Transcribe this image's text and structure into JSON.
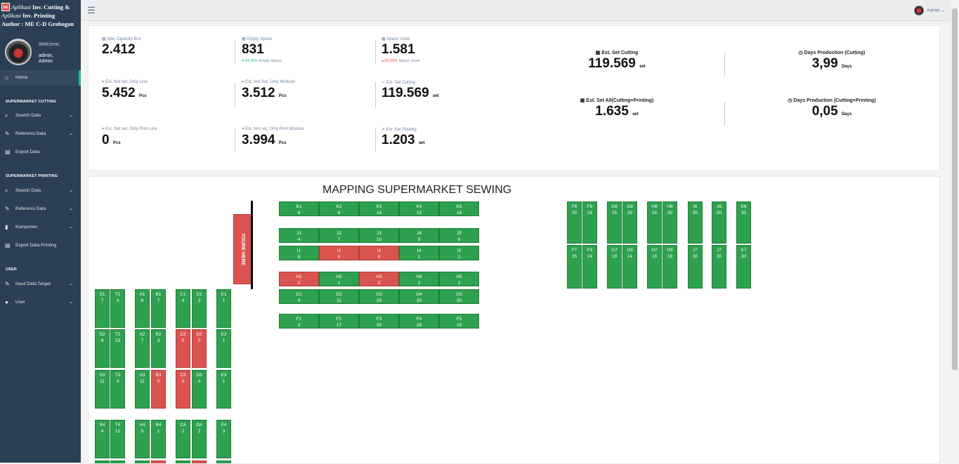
{
  "brand": {
    "logo": "DK",
    "line1_italic": "Aplikasi",
    "line1_bold": "Inv. Cutting &",
    "line2_italic": "Aplikasi",
    "line2_bold": "Inv. Printing",
    "line3": "Author : ME C-D Grobogan"
  },
  "profile": {
    "welcome": "Welcome,",
    "name": "admin,",
    "role": "Admin"
  },
  "nav": {
    "home": "Home",
    "sec_cutting": "SUPERMARKET CUTTING",
    "cut_search": "Search Data",
    "cut_ref": "Referensi Data",
    "cut_export": "Export Data",
    "sec_printing": "SUPERMARKET PRINTING",
    "prt_search": "Search Data",
    "prt_ref": "Referensi Data",
    "prt_komponen": "Komponen",
    "prt_export": "Export Data Printing",
    "sec_user": "USER",
    "input_target": "Input Data Target",
    "user": "User"
  },
  "topbar": {
    "user": "Admin"
  },
  "stats": {
    "max_capacity": {
      "label": "Max Capacity Box",
      "value": "2.412"
    },
    "empty_space": {
      "label": "Empty Space",
      "value": "831",
      "sub_pct": "34,45%",
      "sub_txt": "Empty Space"
    },
    "space_used": {
      "label": "Space Used",
      "value": "1.581",
      "sub_pct": "65,55%",
      "sub_txt": "Space Used"
    },
    "only_line": {
      "label": "Est. Not set, Only Line",
      "value": "5.452",
      "unit": "Pcs"
    },
    "only_modular": {
      "label": "Est. Not Set, Only Modular",
      "value": "3.512",
      "unit": "Pcs"
    },
    "set_cutting_small": {
      "label": "Est. Set Cutting",
      "value": "119.569",
      "unit": "set"
    },
    "print_line": {
      "label": "Est. Not set, Only Print Line",
      "value": "0",
      "unit": "Pcs"
    },
    "print_modular": {
      "label": "Est. Not set, Only Print Modular",
      "value": "3.994",
      "unit": "Pcs"
    },
    "set_printing": {
      "label": "Est. Set Printing",
      "value": "1.203",
      "unit": "set"
    },
    "big_set_cutting": {
      "label": "Est. Set Cutting",
      "value": "119.569",
      "unit": "set"
    },
    "big_days_cutting": {
      "label": "Days Production (Cutting)",
      "value": "3,99",
      "unit": "Days"
    },
    "big_set_all": {
      "label": "Est. Set All(Cutting+Printing)",
      "value": "1.635",
      "unit": "set"
    },
    "big_days_all": {
      "label": "Days Production (Cutting+Printing)",
      "value": "0,05",
      "unit": "Days"
    }
  },
  "map": {
    "title": "MAPPING SUPERMARKET SEWING",
    "youre_here": "YOURE HERE",
    "colors": {
      "ok": "#2ea14f",
      "empty": "#d9534f"
    },
    "rows": [
      [
        "K1",
        "6"
      ],
      [
        "K2",
        "6"
      ],
      [
        "K3",
        "14"
      ],
      [
        "K4",
        "12"
      ],
      [
        "K5",
        "16"
      ],
      [
        "J1",
        "4"
      ],
      [
        "J2",
        "7"
      ],
      [
        "J3",
        "10"
      ],
      [
        "J4",
        "9"
      ],
      [
        "J5",
        "6"
      ],
      [
        "I1",
        "8"
      ],
      [
        "I2",
        "0"
      ],
      [
        "I3",
        "0"
      ],
      [
        "I4",
        "1"
      ],
      [
        "I5",
        "2"
      ],
      [
        "H1",
        "0"
      ],
      [
        "H2",
        "1"
      ],
      [
        "H3",
        "0"
      ],
      [
        "H4",
        "2"
      ],
      [
        "H5",
        "2"
      ],
      [
        "G1",
        "4"
      ],
      [
        "G2",
        "11"
      ],
      [
        "G3",
        "29"
      ],
      [
        "G4",
        "30"
      ],
      [
        "G5",
        "30"
      ],
      [
        "F1",
        "3"
      ],
      [
        "F2",
        "17"
      ],
      [
        "F3",
        "30"
      ],
      [
        "F4",
        "28"
      ],
      [
        "F5",
        "19"
      ]
    ],
    "right_top": [
      [
        "F6",
        "20"
      ],
      [
        "F8",
        "16"
      ],
      [
        "G6",
        "15"
      ],
      [
        "G8",
        "20"
      ],
      [
        "H6",
        "14"
      ],
      [
        "H8",
        "30"
      ],
      [
        "I6",
        "30"
      ],
      [
        "J6",
        "30"
      ],
      [
        "K6",
        "30"
      ]
    ],
    "right_bottom": [
      [
        "F7",
        "25"
      ],
      [
        "F9",
        "24"
      ],
      [
        "G7",
        "19"
      ],
      [
        "G9",
        "14"
      ],
      [
        "H7",
        "16"
      ],
      [
        "H9",
        "18"
      ],
      [
        "I7",
        "30"
      ],
      [
        "J7",
        "30"
      ],
      [
        "K7",
        "30"
      ]
    ],
    "left_rows": [
      [
        [
          "S1",
          "7"
        ],
        [
          "T1",
          "4"
        ],
        [
          "A1",
          "6"
        ],
        [
          "B1",
          "7"
        ],
        [
          "C1",
          "4"
        ],
        [
          "D1",
          "3"
        ],
        [
          "E1",
          "1"
        ]
      ],
      [
        [
          "S2",
          "9"
        ],
        [
          "T2",
          "13"
        ],
        [
          "A2",
          "7"
        ],
        [
          "B2",
          "3"
        ],
        [
          "C2",
          "0"
        ],
        [
          "D2",
          "0"
        ],
        [
          "E2",
          "1"
        ]
      ],
      [
        [
          "S3",
          "11"
        ],
        [
          "T3",
          "4"
        ],
        [
          "A3",
          "11"
        ],
        [
          "B3",
          "0"
        ],
        [
          "C3",
          "0"
        ],
        [
          "D3",
          "4"
        ],
        [
          "E3",
          "1"
        ]
      ],
      [
        [
          "S4",
          "4"
        ],
        [
          "T4",
          "12"
        ],
        [
          "A4",
          "5"
        ],
        [
          "B4",
          "1"
        ],
        [
          "C4",
          "2"
        ],
        [
          "D4",
          "2"
        ],
        [
          "E4",
          "3"
        ]
      ]
    ]
  }
}
